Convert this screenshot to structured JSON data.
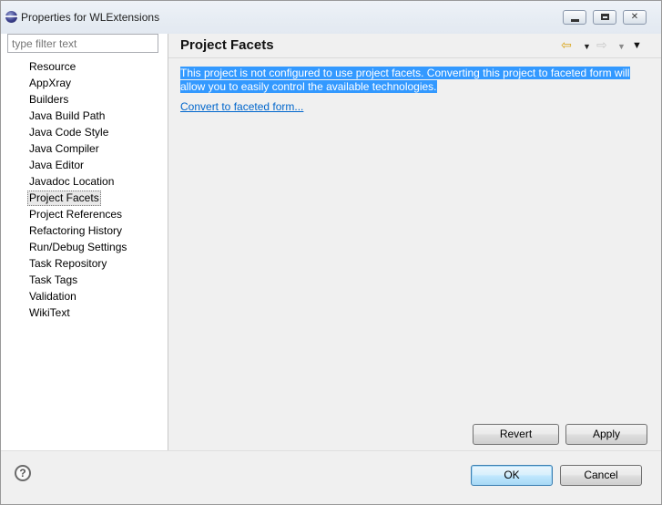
{
  "window": {
    "title": "Properties for WLExtensions",
    "min_glyph": "",
    "max_glyph": "",
    "close_glyph": "✕"
  },
  "sidebar": {
    "filter_placeholder": "type filter text",
    "items": [
      {
        "label": "Resource"
      },
      {
        "label": "AppXray"
      },
      {
        "label": "Builders"
      },
      {
        "label": "Java Build Path"
      },
      {
        "label": "Java Code Style"
      },
      {
        "label": "Java Compiler"
      },
      {
        "label": "Java Editor"
      },
      {
        "label": "Javadoc Location"
      },
      {
        "label": "Project Facets",
        "selected": true
      },
      {
        "label": "Project References"
      },
      {
        "label": "Refactoring History"
      },
      {
        "label": "Run/Debug Settings"
      },
      {
        "label": "Task Repository"
      },
      {
        "label": "Task Tags"
      },
      {
        "label": "Validation"
      },
      {
        "label": "WikiText"
      }
    ]
  },
  "page": {
    "title": "Project Facets",
    "message": "This project is not configured to use project facets. Converting this project to faceted form will allow you to easily control the available technologies.",
    "link": "Convert to faceted form...",
    "nav": {
      "back_icon": "⇦",
      "forward_icon": "⇨",
      "menu_arrow": "▼",
      "view_menu_icon": "▼"
    }
  },
  "buttons": {
    "revert": "Revert",
    "apply": "Apply",
    "ok": "OK",
    "cancel": "Cancel",
    "help": "?"
  },
  "colors": {
    "selection": "#3399ff",
    "link": "#0066cc"
  }
}
